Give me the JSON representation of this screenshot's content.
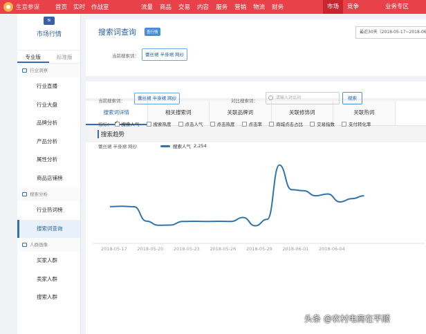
{
  "top_nav": {
    "logo_text": "生意参谋",
    "left_items": [
      "首页",
      "实时",
      "作战室"
    ],
    "mid_items": [
      "流量",
      "商品",
      "交易",
      "内容",
      "服务",
      "营销",
      "物流",
      "财务"
    ],
    "right_items": [
      "市场",
      "竞争"
    ],
    "business_zone": "业务专区",
    "active_item": "市场",
    "accent_color": "#e8414a"
  },
  "sidebar": {
    "badge": "Bi",
    "title": "市场行情",
    "version_tabs": [
      "专业版",
      "标准版"
    ],
    "sections": [
      {
        "title": "行业洞察",
        "items": [
          "行业直播",
          "行业大盘",
          "品牌分析",
          "产品分析",
          "属性分析",
          "商品店铺榜"
        ]
      },
      {
        "title": "搜索分析",
        "items": [
          "行业热词榜",
          "搜索词查询"
        ]
      },
      {
        "title": "人群画像",
        "items": [
          "买家人群",
          "卖家人群",
          "搜索人群"
        ]
      }
    ],
    "active_item": "搜索词查询"
  },
  "header": {
    "title": "搜索词查询",
    "tag": "查行情",
    "date_range": "最近30天（2018-05-17~2018-06-15）",
    "current_query_label": "当前搜索词：",
    "current_query": "蕾丝裙 半身裙 网纱"
  },
  "tabs": [
    "搜索词详情",
    "相关搜索词",
    "关联品牌词",
    "关联修饰词",
    "关联热词"
  ],
  "active_tab": "搜索词详情",
  "section_title": "搜索趋势",
  "query_row": {
    "current_label": "当前搜索词：",
    "current_value": "蕾丝裙 半身裙 网纱",
    "compare_label": "对比搜索词：",
    "compare_placeholder": "请输入对比词",
    "search_button": "搜索"
  },
  "metrics": {
    "label": "指标：",
    "items": [
      {
        "label": "搜索人气",
        "checked": true
      },
      {
        "label": "搜索热度",
        "checked": false
      },
      {
        "label": "点击人气",
        "checked": false
      },
      {
        "label": "点击热度",
        "checked": false
      },
      {
        "label": "点击率",
        "checked": false
      },
      {
        "label": "商城点击占比",
        "checked": false
      },
      {
        "label": "交易指数",
        "checked": false
      },
      {
        "label": "支付转化率",
        "checked": false
      }
    ]
  },
  "legend": {
    "keyword": "蕾丝裙 半身裙 网纱",
    "series_name": "搜索人气",
    "series_value": "2,254",
    "series_color": "#2e73ae"
  },
  "chart_data": {
    "type": "line",
    "x": [
      "2018-05-17",
      "2018-05-18",
      "2018-05-19",
      "2018-05-20",
      "2018-05-21",
      "2018-05-22",
      "2018-05-23",
      "2018-05-24",
      "2018-05-25",
      "2018-05-26",
      "2018-05-27",
      "2018-05-28",
      "2018-05-29",
      "2018-05-30",
      "2018-05-31",
      "2018-06-01",
      "2018-06-02",
      "2018-06-03",
      "2018-06-04",
      "2018-06-05",
      "2018-06-06",
      "2018-06-07"
    ],
    "x_tick_labels": [
      "2018-05-17",
      "2018-05-20",
      "2018-05-23",
      "2018-05-26",
      "2018-05-29",
      "2018-06-01",
      "2018-06-04"
    ],
    "series": [
      {
        "name": "搜索人气",
        "values": [
          1650,
          1660,
          1645,
          1250,
          1135,
          1140,
          1240,
          1245,
          1240,
          1245,
          1240,
          1350,
          1120,
          1300,
          2800,
          2120,
          2090,
          1950,
          2000,
          1780,
          1870,
          1950
        ]
      }
    ],
    "ylim": [
      900,
      3100
    ]
  },
  "watermark": "头条 @农村电商在平顺"
}
